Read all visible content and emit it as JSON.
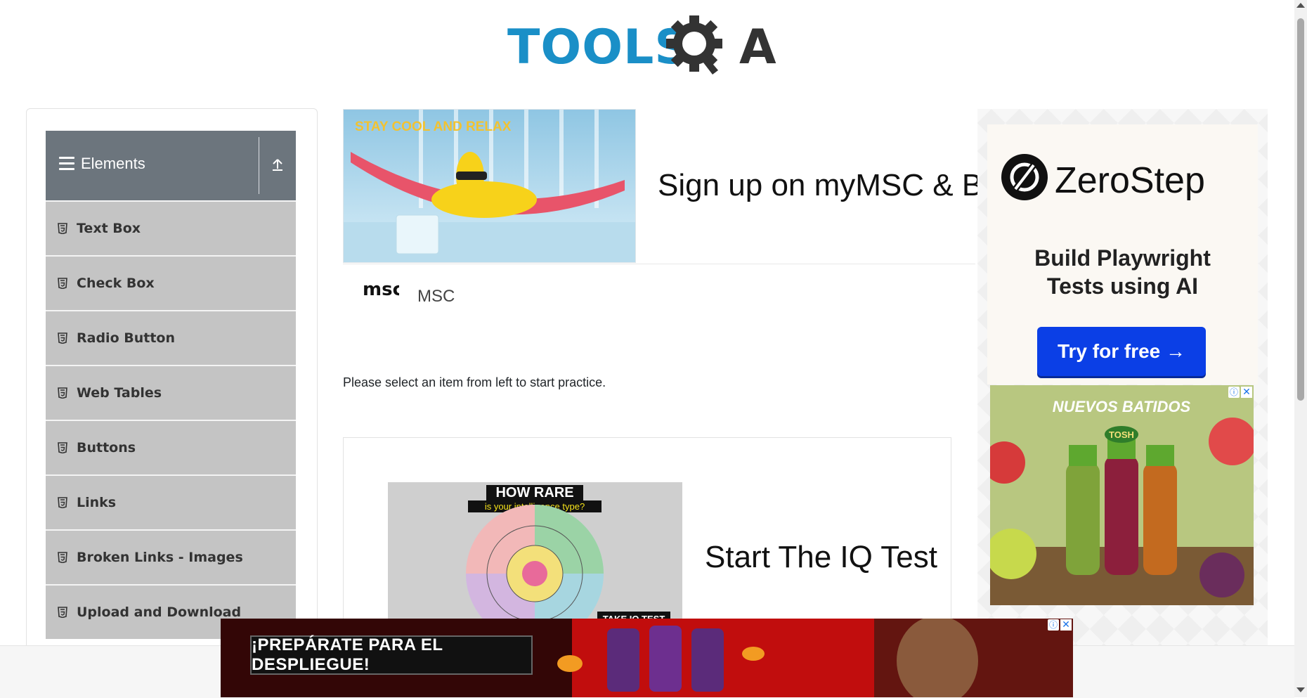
{
  "header": {
    "logo_text": "TOOLSQA",
    "logo_part1": "TOOLS",
    "logo_part2": "A"
  },
  "sidebar": {
    "group_title": "Elements",
    "items": [
      {
        "label": "Text Box"
      },
      {
        "label": "Check Box"
      },
      {
        "label": "Radio Button"
      },
      {
        "label": "Web Tables"
      },
      {
        "label": "Buttons"
      },
      {
        "label": "Links"
      },
      {
        "label": "Broken Links - Images"
      },
      {
        "label": "Upload and Download"
      }
    ]
  },
  "top_ad": {
    "banner_text": "STAY COOL AND RELAX",
    "headline": "Sign up on myMSC & B",
    "brand_logo": "msc",
    "brand_name": "MSC"
  },
  "main": {
    "instruction": "Please select an item from left to start practice."
  },
  "iq_ad": {
    "image_title": "HOW RARE",
    "image_subtitle": "is your intelligence type?",
    "image_badge": "TAKE IQ TEST",
    "title": "Start The IQ Test"
  },
  "right_ad": {
    "brand": "ZeroStep",
    "tagline_line1": "Build Playwright",
    "tagline_line2": "Tests using AI",
    "cta": "Try for free →",
    "tosh_headline": "NUEVOS BATIDOS",
    "tosh_brand": "TOSH"
  },
  "bottom_ad": {
    "cta": "¡PREPÁRATE PARA EL DESPLIEGUE!"
  },
  "colors": {
    "logo_blue": "#1a8fc7",
    "logo_dark": "#333333",
    "sidebar_header": "#6c757d",
    "menu_item_bg": "#c4c4c4",
    "cta_blue": "#0b3fe6",
    "bottom_ad_red": "#c10d0d"
  }
}
